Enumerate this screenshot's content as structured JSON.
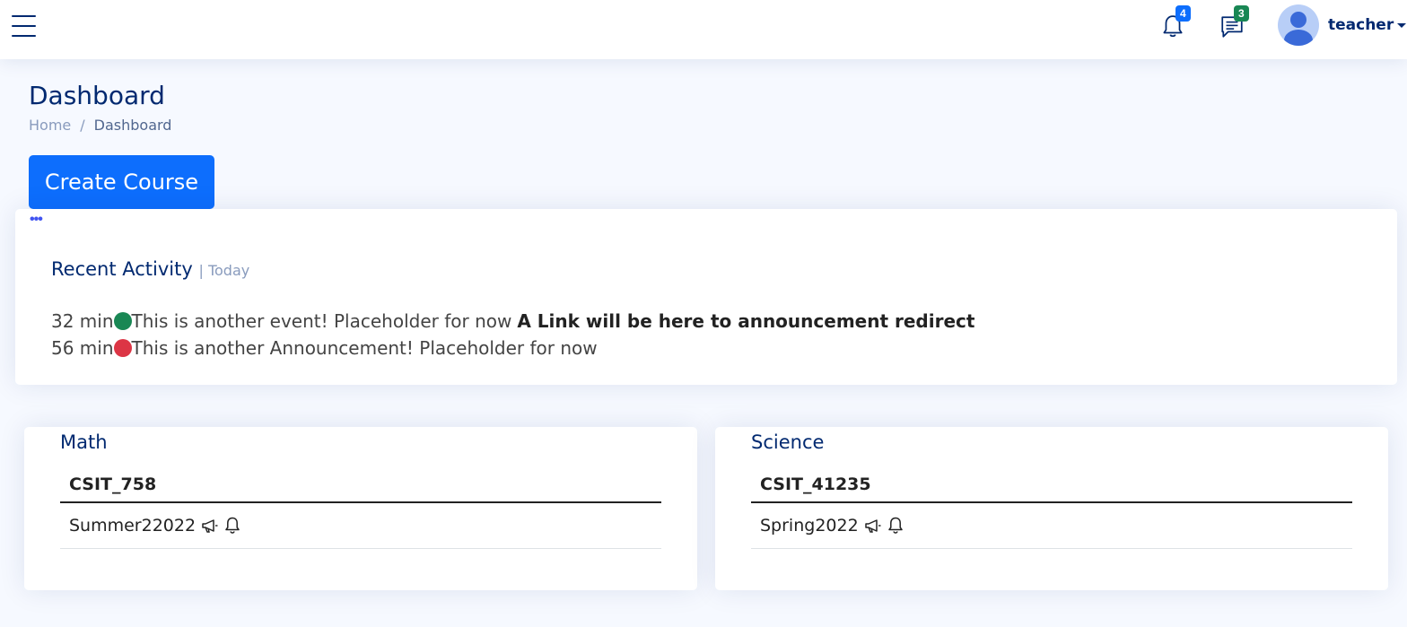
{
  "header": {
    "notifications": {
      "icon": "bell-icon",
      "count": "4"
    },
    "messages": {
      "icon": "chat-icon",
      "count": "3"
    },
    "profile": {
      "name": "teacher",
      "icon": "person-icon"
    }
  },
  "page": {
    "title": "Dashboard",
    "breadcrumb": {
      "home": "Home",
      "separator": "/",
      "current": "Dashboard"
    },
    "create_button": "Create Course"
  },
  "activity": {
    "menu": "•••",
    "title": "Recent Activity",
    "subtitle": "| Today",
    "items": [
      {
        "time": "32 min",
        "color": "#198754",
        "text": "This is another event! Placeholder for now",
        "link": "A Link will be here to announcement redirect"
      },
      {
        "time": "56 min",
        "color": "#dc3545",
        "text": "This is another Announcement! Placeholder for now",
        "link": ""
      }
    ]
  },
  "courses": [
    {
      "title": "Math",
      "code": "CSIT_758",
      "term": "Summer22022",
      "icons": [
        "megaphone-icon",
        "bell-icon"
      ]
    },
    {
      "title": "Science",
      "code": "CSIT_41235",
      "term": "Spring2022",
      "icons": [
        "megaphone-icon",
        "bell-icon"
      ]
    }
  ],
  "colors": {
    "primary": "#0d6efd",
    "navy": "#012970",
    "success": "#198754",
    "danger": "#dc3545",
    "background": "#f6f9ff"
  }
}
